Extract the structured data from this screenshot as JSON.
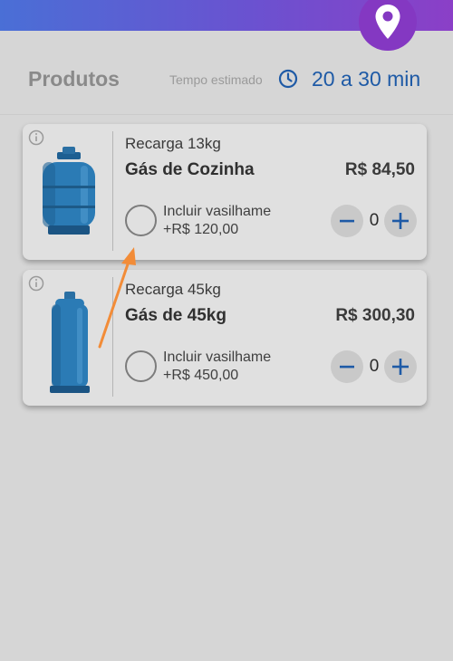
{
  "header": {
    "title": "Produtos",
    "eta_label": "Tempo estimado",
    "eta_value": "20 a 30 min"
  },
  "icons": {
    "location": "location-pin-icon",
    "clock": "clock-icon",
    "info": "info-icon",
    "minus": "minus-icon",
    "plus": "plus-icon"
  },
  "colors": {
    "accent_blue": "#1e5aa6",
    "top_gradient_start": "#4a6fd6",
    "top_gradient_end": "#8b3fc7",
    "annotation_arrow": "#f28c38"
  },
  "products": [
    {
      "subtitle": "Recarga 13kg",
      "name": "Gás de Cozinha",
      "price": "R$ 84,50",
      "option_label": "Incluir vasilhame",
      "option_price": "+R$ 120,00",
      "quantity": "0"
    },
    {
      "subtitle": "Recarga 45kg",
      "name": "Gás de 45kg",
      "price": "R$ 300,30",
      "option_label": "Incluir vasilhame",
      "option_price": "+R$ 450,00",
      "quantity": "0"
    }
  ]
}
